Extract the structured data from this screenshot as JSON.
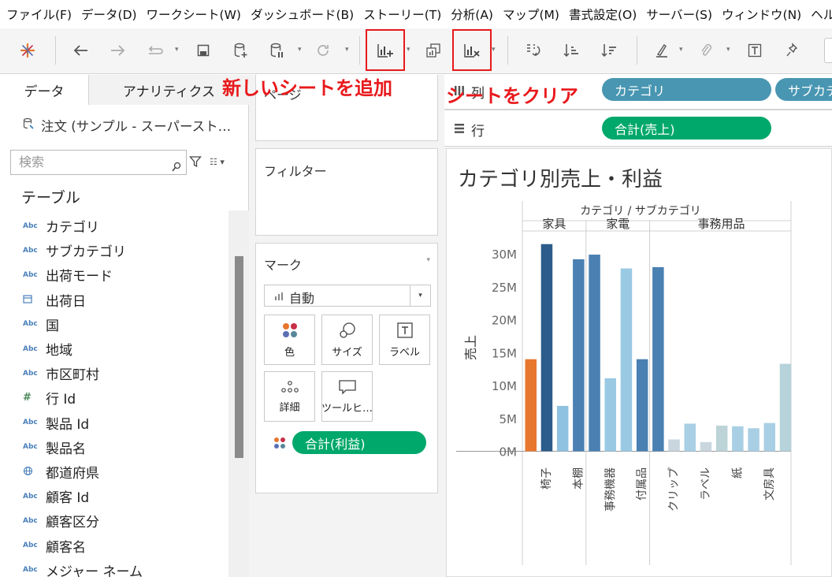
{
  "menu": [
    "ファイル(F)",
    "データ(D)",
    "ワークシート(W)",
    "ダッシュボード(B)",
    "ストーリー(T)",
    "分析(A)",
    "マップ(M)",
    "書式設定(O)",
    "サーバー(S)",
    "ウィンドウ(N)",
    "ヘルプ(H)"
  ],
  "annotations": {
    "new_sheet": "新しいシートを追加",
    "clear_sheet": "シートをクリア"
  },
  "left_pane": {
    "tabs": [
      "データ",
      "アナリティクス"
    ],
    "datasource": "注文 (サンプル - スーパースト…",
    "search_placeholder": "検索",
    "tables_heading": "テーブル",
    "fields": [
      {
        "type": "Abc",
        "label": "カテゴリ"
      },
      {
        "type": "Abc",
        "label": "サブカテゴリ"
      },
      {
        "type": "Abc",
        "label": "出荷モード"
      },
      {
        "type": "date",
        "label": "出荷日"
      },
      {
        "type": "Abc",
        "label": "国"
      },
      {
        "type": "Abc",
        "label": "地域"
      },
      {
        "type": "Abc",
        "label": "市区町村"
      },
      {
        "type": "#",
        "label": "行 Id"
      },
      {
        "type": "Abc",
        "label": "製品 Id"
      },
      {
        "type": "Abc",
        "label": "製品名"
      },
      {
        "type": "geo",
        "label": "都道府県"
      },
      {
        "type": "Abc",
        "label": "顧客 Id"
      },
      {
        "type": "Abc",
        "label": "顧客区分"
      },
      {
        "type": "Abc",
        "label": "顧客名"
      },
      {
        "type": "Abc",
        "label": "メジャー ネーム"
      }
    ]
  },
  "cards": {
    "pages": "ページ",
    "filters": "フィルター",
    "marks": "マーク",
    "mark_type": "自動",
    "mark_buttons": [
      "色",
      "サイズ",
      "ラベル",
      "詳細",
      "ツールヒ…"
    ],
    "color_pill": "合計(利益)"
  },
  "shelves": {
    "columns_label": "列",
    "columns_pills": [
      "カテゴリ",
      "サブカテゴリ"
    ],
    "rows_label": "行",
    "rows_pills": [
      "合計(売上)"
    ]
  },
  "colors": {
    "accent_red": "#e8191c",
    "pill_green": "#00a86b",
    "pill_blue": "#4996b2"
  },
  "chart_data": {
    "type": "bar",
    "title": "カテゴリ別売上・利益",
    "header_title": "カテゴリ / サブカテゴリ",
    "ylabel": "売上",
    "ylim": [
      -1500000,
      33500000
    ],
    "yticks": [
      0,
      5000000,
      10000000,
      15000000,
      20000000,
      25000000,
      30000000
    ],
    "ytick_labels": [
      "0M",
      "5M",
      "10M",
      "15M",
      "20M",
      "25M",
      "30M"
    ],
    "groups": [
      {
        "name": "家具",
        "categories": [
          "",
          "椅子",
          "",
          "本棚"
        ],
        "values": [
          14000000,
          31500000,
          6900000,
          29200000
        ],
        "colors": [
          "#e8772e",
          "#2b5c8a",
          "#8fc1e0",
          "#4a80b2"
        ]
      },
      {
        "name": "家電",
        "categories": [
          "",
          "事務機器",
          "",
          "付属品"
        ],
        "values": [
          29900000,
          11100000,
          27800000,
          14000000
        ],
        "colors": [
          "#4a80b2",
          "#9ac9e3",
          "#9ac9e3",
          "#4a80b2"
        ]
      },
      {
        "name": "事務用品",
        "categories": [
          "",
          "クリップ",
          "",
          "ラベル",
          "",
          "紙",
          "",
          "文房具"
        ],
        "values": [
          28000000,
          1800000,
          4200000,
          1400000,
          3900000,
          3800000,
          3500000,
          4300000,
          13300000
        ],
        "colors": [
          "#4a80b2",
          "#c9d6de",
          "#a9cfe4",
          "#c9d6de",
          "#bcd4d8",
          "#a9cfe4",
          "#a9cfe4",
          "#a9cfe4",
          "#b6d2db"
        ]
      }
    ]
  }
}
